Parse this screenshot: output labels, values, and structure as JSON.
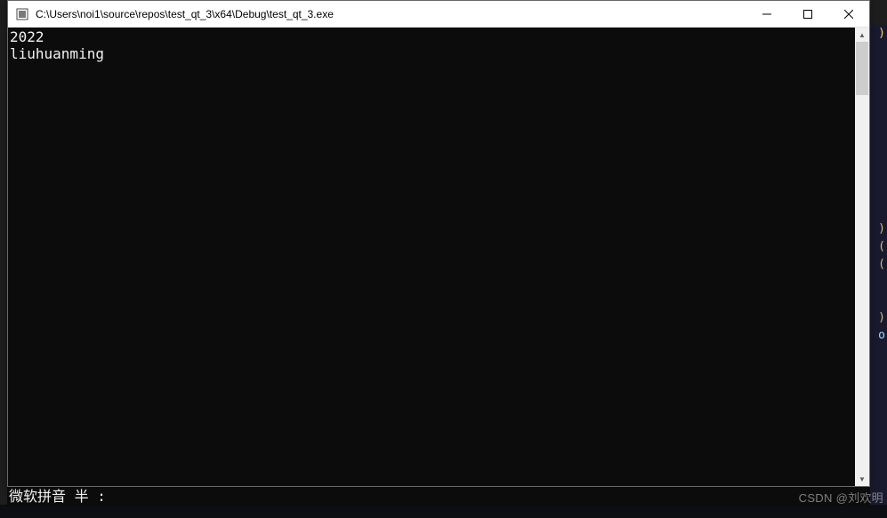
{
  "window": {
    "title": "C:\\Users\\noi1\\source\\repos\\test_qt_3\\x64\\Debug\\test_qt_3.exe",
    "icon_name": "application-icon"
  },
  "controls": {
    "minimize": "minimize-icon",
    "maximize": "maximize-icon",
    "close": "close-icon"
  },
  "console": {
    "lines": [
      "2022",
      "liuhuanming"
    ]
  },
  "ime": {
    "text": "微软拼音 半 :"
  },
  "background": {
    "punct_lines": [
      "",
      "",
      "",
      "",
      "",
      "",
      "",
      "",
      "",
      "",
      "",
      "",
      ")",
      ")",
      "(",
      "(",
      "",
      "",
      ")",
      "o"
    ],
    "bottom_fragment": ""
  },
  "watermark": "CSDN @刘欢明"
}
